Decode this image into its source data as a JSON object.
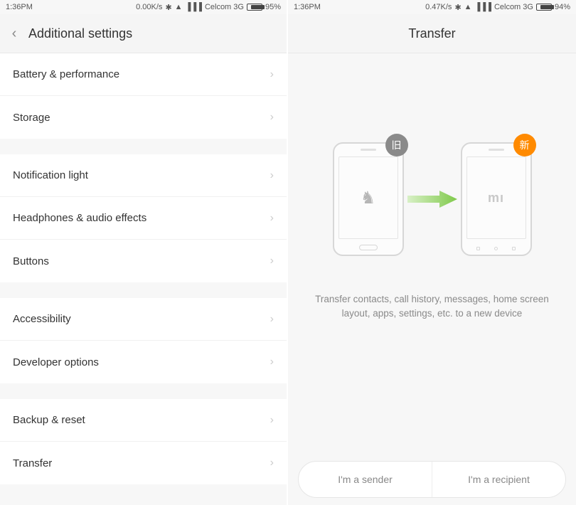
{
  "left": {
    "status": {
      "time": "1:36PM",
      "speed": "0.00K/s",
      "carrier": "Celcom 3G",
      "battery_pct": "95%",
      "battery_fill": 95
    },
    "header": {
      "title": "Additional settings"
    },
    "groups": [
      {
        "items": [
          {
            "label": "Battery & performance"
          },
          {
            "label": "Storage"
          }
        ]
      },
      {
        "items": [
          {
            "label": "Notification light"
          },
          {
            "label": "Headphones & audio effects"
          },
          {
            "label": "Buttons"
          }
        ]
      },
      {
        "items": [
          {
            "label": "Accessibility"
          },
          {
            "label": "Developer options"
          }
        ]
      },
      {
        "items": [
          {
            "label": "Backup & reset"
          },
          {
            "label": "Transfer"
          }
        ]
      }
    ]
  },
  "right": {
    "status": {
      "time": "1:36PM",
      "speed": "0.47K/s",
      "carrier": "Celcom 3G",
      "battery_pct": "94%",
      "battery_fill": 94
    },
    "header": {
      "title": "Transfer"
    },
    "badge_old": "旧",
    "badge_new": "新",
    "mi_label": "mı",
    "description": "Transfer contacts, call history, messages, home screen layout, apps, settings, etc. to a new device",
    "buttons": {
      "sender": "I'm a sender",
      "recipient": "I'm a recipient"
    }
  }
}
